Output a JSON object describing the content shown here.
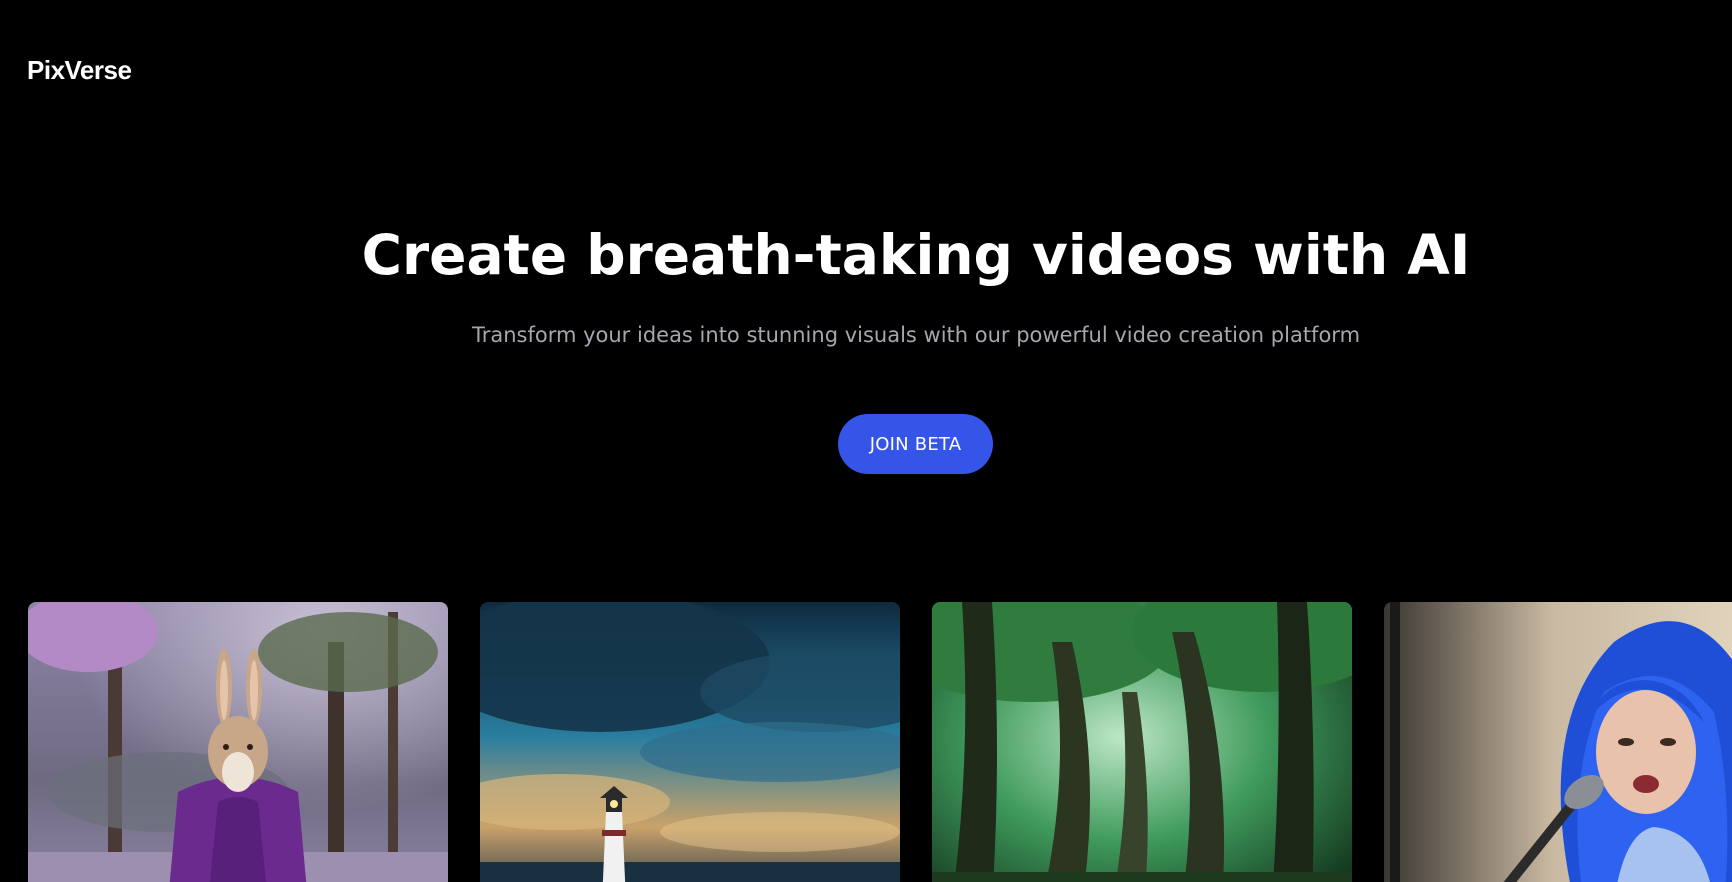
{
  "header": {
    "logo": "PixVerse"
  },
  "hero": {
    "title": "Create breath-taking videos with AI",
    "subtitle": "Transform your ideas into stunning visuals with our powerful video creation platform",
    "cta_label": "JOIN BETA"
  },
  "colors": {
    "background": "#000000",
    "accent": "#3554e8",
    "subtitle": "#a6a6ad"
  },
  "gallery": {
    "items": [
      {
        "subject": "rabbit-in-purple-robe-thumbnail"
      },
      {
        "subject": "lighthouse-storm-thumbnail"
      },
      {
        "subject": "green-forest-thumbnail"
      },
      {
        "subject": "blue-haired-singer-thumbnail"
      }
    ]
  }
}
